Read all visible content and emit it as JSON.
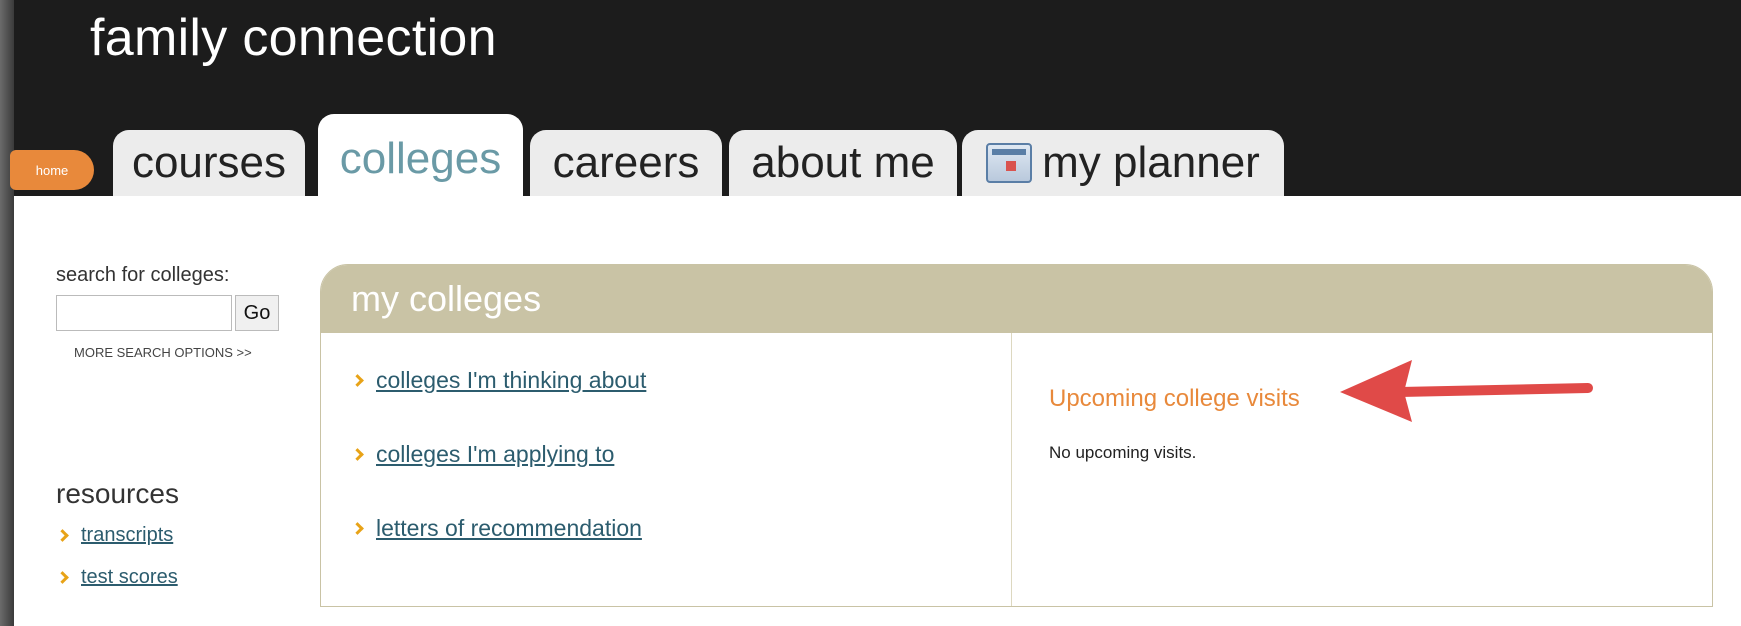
{
  "header": {
    "title": "family connection",
    "home_label": "home",
    "tabs": [
      {
        "label": "courses",
        "active": false
      },
      {
        "label": "colleges",
        "active": true
      },
      {
        "label": "careers",
        "active": false
      },
      {
        "label": "about me",
        "active": false
      },
      {
        "label": "my planner",
        "active": false,
        "icon": "calendar-icon"
      }
    ]
  },
  "sidebar": {
    "search_label": "search for colleges:",
    "search_value": "",
    "go_label": "Go",
    "more_options": "MORE SEARCH OPTIONS >>",
    "resources_title": "resources",
    "resources": [
      "transcripts",
      "test scores"
    ]
  },
  "panel": {
    "title": "my colleges",
    "links": [
      "colleges I'm thinking about",
      "colleges I'm applying to",
      "letters of recommendation"
    ],
    "visits_title": "Upcoming college visits",
    "visits_empty": "No upcoming visits."
  },
  "colors": {
    "header_bg": "#1c1c1c",
    "accent_orange": "#e8893b",
    "panel_header": "#c9c3a5",
    "link_color": "#2c5c6e",
    "active_tab_text": "#6a9aa6",
    "annotation_arrow": "#e04a48"
  }
}
